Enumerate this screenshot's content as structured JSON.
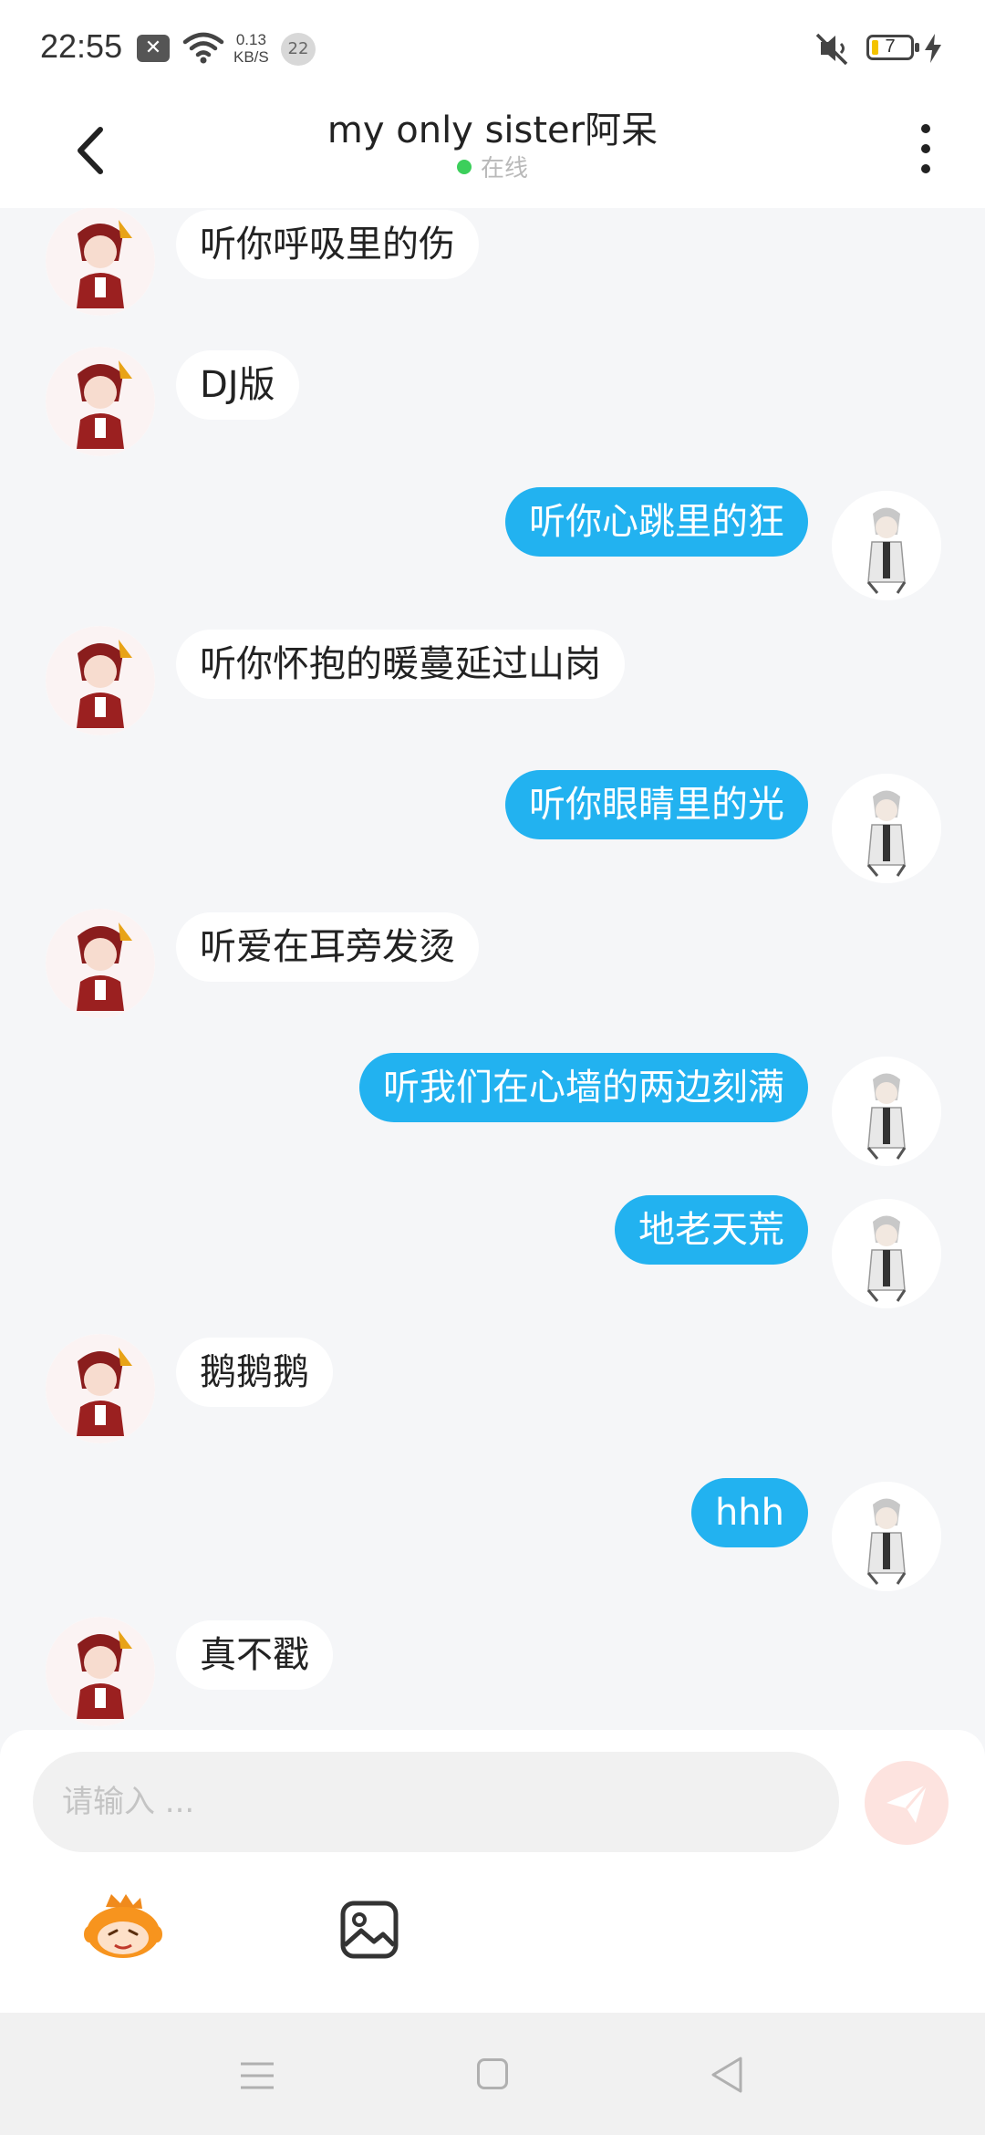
{
  "status_bar": {
    "time": "22:55",
    "net_speed_value": "0.13",
    "net_speed_unit": "KB/S",
    "notification_count": "22",
    "battery_level": "7"
  },
  "header": {
    "title": "my only sister阿呆",
    "status": "在线",
    "status_color": "#3ccf5b"
  },
  "messages": [
    {
      "side": "left",
      "text": "听你呼吸里的伤"
    },
    {
      "side": "left",
      "text": "DJ版"
    },
    {
      "side": "right",
      "text": "听你心跳里的狂"
    },
    {
      "side": "left",
      "text": "听你怀抱的暖蔓延过山岗"
    },
    {
      "side": "right",
      "text": "听你眼睛里的光"
    },
    {
      "side": "left",
      "text": "听爱在耳旁发烫"
    },
    {
      "side": "right",
      "text": "听我们在心墙的两边刻满"
    },
    {
      "side": "right",
      "text": "地老天荒"
    },
    {
      "side": "left",
      "text": "鹅鹅鹅"
    },
    {
      "side": "right",
      "text": "hhh"
    },
    {
      "side": "left",
      "text": "真不戳"
    }
  ],
  "input": {
    "placeholder": "请输入 ...",
    "value": ""
  },
  "icons": {
    "back": "chevron-left-icon",
    "more": "more-vertical-icon",
    "send": "send-icon",
    "emoji": "emoji-icon",
    "image": "image-icon"
  },
  "colors": {
    "outgoing_bubble": "#22b2f0",
    "incoming_bubble": "#ffffff",
    "send_button": "#fde3df"
  }
}
